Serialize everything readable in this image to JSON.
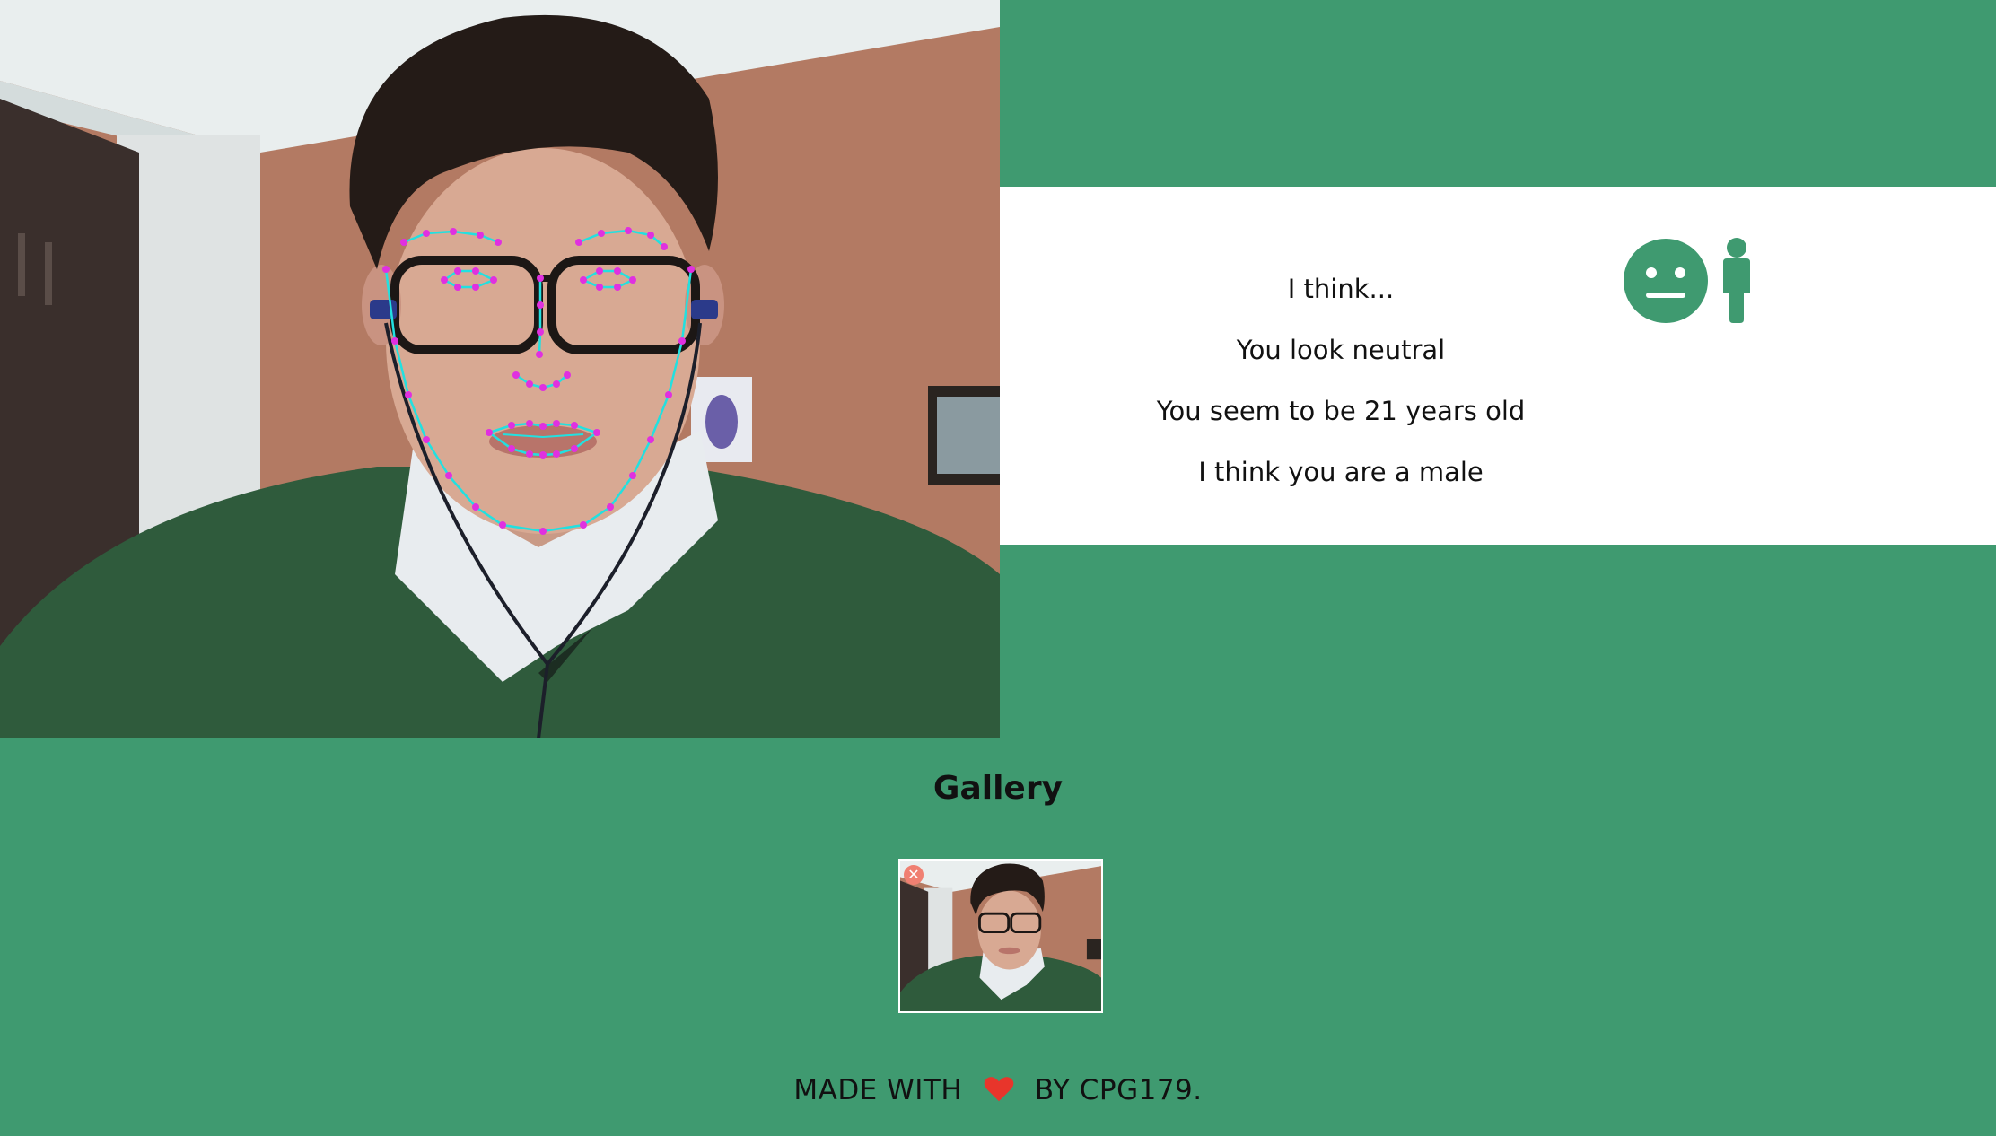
{
  "result": {
    "intro": "I think...",
    "emotion_text": "You look neutral",
    "age_text": "You seem to be 21 years old",
    "gender_text": "I think you are a male",
    "icons": [
      "neutral-face-icon",
      "male-person-icon"
    ]
  },
  "gallery": {
    "title": "Gallery",
    "items": [
      {
        "close_glyph": "✕"
      }
    ]
  },
  "footer": {
    "prefix": "MADE WITH",
    "suffix": "BY CPG179."
  },
  "colors": {
    "background": "#3f9a70",
    "panel": "#ffffff",
    "icon": "#3f9a70",
    "heart": "#e8352b",
    "landmark_lines": "#22e0e0",
    "landmark_points": "#e030e0"
  }
}
